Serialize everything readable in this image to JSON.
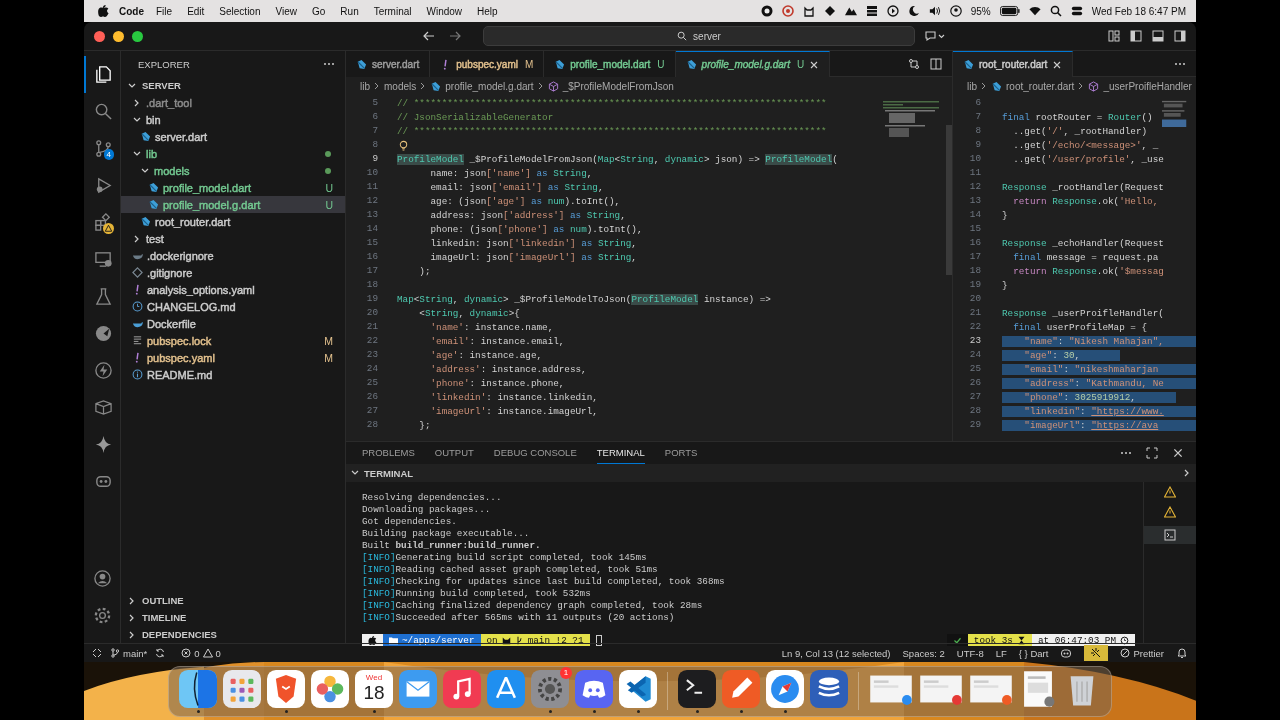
{
  "menubar": {
    "app": "Code",
    "menus": [
      "File",
      "Edit",
      "Selection",
      "View",
      "Go",
      "Run",
      "Terminal",
      "Window",
      "Help"
    ],
    "battery": "95%",
    "clock": "Wed Feb 18  6:47 PM"
  },
  "window": {
    "search": "server"
  },
  "activity_bar": [
    {
      "kind": "files",
      "selected": true
    },
    {
      "kind": "search",
      "selected": false
    },
    {
      "kind": "scm",
      "selected": false,
      "badge": "4"
    },
    {
      "kind": "debug",
      "selected": false
    },
    {
      "kind": "extensions",
      "selected": false
    },
    {
      "kind": "remote",
      "selected": false
    },
    {
      "kind": "testing",
      "selected": false
    },
    {
      "kind": "flutter",
      "selected": false
    },
    {
      "kind": "bolt",
      "selected": false
    },
    {
      "kind": "box",
      "selected": false
    },
    {
      "kind": "sparkle",
      "selected": false
    },
    {
      "kind": "bot",
      "selected": false
    }
  ],
  "sidebar": {
    "title": "EXPLORER",
    "root": "SERVER",
    "tree": [
      {
        "name": ".dart_tool",
        "kind": "folder",
        "color": "#8c8c8c",
        "expanded": false,
        "selected": false
      },
      {
        "name": "bin",
        "kind": "folder",
        "color": "#cccccc",
        "expanded": true,
        "selected": false,
        "children": [
          {
            "name": "server.dart",
            "kind": "dart",
            "color": "#cccccc",
            "selected": false
          }
        ]
      },
      {
        "name": "lib",
        "kind": "folder",
        "color": "#73c991",
        "changes_inside": true,
        "expanded": true,
        "selected": false,
        "children": [
          {
            "name": "models",
            "kind": "folder",
            "color": "#73c991",
            "changes_inside": true,
            "expanded": true,
            "selected": false,
            "children": [
              {
                "name": "profile_model.dart",
                "kind": "dart",
                "color": "#73c991",
                "badge": "U",
                "selected": false
              },
              {
                "name": "profile_model.g.dart",
                "kind": "dart",
                "color": "#73c991",
                "badge": "U",
                "selected": true
              }
            ]
          },
          {
            "name": "root_router.dart",
            "kind": "dart",
            "color": "#cccccc",
            "selected": false
          }
        ]
      },
      {
        "name": "test",
        "kind": "folder",
        "color": "#cccccc",
        "expanded": false,
        "selected": false
      },
      {
        "name": ".dockerignore",
        "kind": "dockerignore",
        "color": "#cccccc",
        "selected": false
      },
      {
        "name": ".gitignore",
        "kind": "git",
        "color": "#cccccc",
        "selected": false
      },
      {
        "name": "analysis_options.yaml",
        "kind": "yaml",
        "color": "#cccccc",
        "selected": false
      },
      {
        "name": "CHANGELOG.md",
        "kind": "changelog",
        "color": "#cccccc",
        "selected": false
      },
      {
        "name": "Dockerfile",
        "kind": "docker",
        "color": "#cccccc",
        "selected": false
      },
      {
        "name": "pubspec.lock",
        "kind": "lock",
        "color": "#e2c08d",
        "badge": "M",
        "selected": false
      },
      {
        "name": "pubspec.yaml",
        "kind": "yaml",
        "color": "#e2c08d",
        "badge": "M",
        "selected": false
      },
      {
        "name": "README.md",
        "kind": "info",
        "color": "#cccccc",
        "selected": false
      }
    ],
    "sections": [
      "OUTLINE",
      "TIMELINE",
      "DEPENDENCIES"
    ]
  },
  "editor": {
    "tabs": [
      {
        "label": "server.dart",
        "kind": "dart",
        "color": "#9d9d9d",
        "selected": false,
        "preview": false
      },
      {
        "label": "pubspec.yaml",
        "kind": "yaml",
        "color": "#e2c08d",
        "badge": "M",
        "selected": false,
        "preview": false
      },
      {
        "label": "profile_model.dart",
        "kind": "dart",
        "color": "#73c991",
        "badge": "U",
        "selected": false,
        "preview": false
      },
      {
        "label": "profile_model.g.dart",
        "kind": "dart",
        "color": "#73c991",
        "badge": "U",
        "selected": true,
        "preview": true
      }
    ],
    "breadcrumbs": [
      "lib",
      "models",
      "profile_model.g.dart",
      "_$ProfileModelFromJson"
    ],
    "lines": [
      {
        "n": "5",
        "active": false,
        "tokens": [
          {
            "kind": "comment",
            "text": "// **************************************************************************"
          }
        ]
      },
      {
        "n": "6",
        "active": false,
        "tokens": [
          {
            "kind": "comment",
            "text": "// JsonSerializableGenerator"
          }
        ]
      },
      {
        "n": "7",
        "active": false,
        "tokens": [
          {
            "kind": "comment",
            "text": "// **************************************************************************"
          }
        ]
      },
      {
        "n": "8",
        "active": false,
        "lightbulb": true
      },
      {
        "n": "9",
        "active": true,
        "tokens": [
          {
            "kind": "typesel",
            "text": "ProfileModel"
          },
          {
            "kind": "plain",
            "text": " _$ProfileModelFromJson("
          },
          {
            "kind": "type",
            "text": "Map"
          },
          {
            "kind": "plain",
            "text": "<"
          },
          {
            "kind": "type",
            "text": "String"
          },
          {
            "kind": "plain",
            "text": ", "
          },
          {
            "kind": "type",
            "text": "dynamic"
          },
          {
            "kind": "plain",
            "text": "> json) => "
          },
          {
            "kind": "typesel",
            "text": "ProfileModel"
          },
          {
            "kind": "plain",
            "text": "("
          }
        ]
      },
      {
        "n": "10",
        "active": false,
        "tokens": [
          {
            "kind": "plain",
            "text": "      name: json"
          },
          {
            "kind": "string",
            "text": "['name']"
          },
          {
            "kind": "keyword",
            "text": " as "
          },
          {
            "kind": "type",
            "text": "String"
          },
          {
            "kind": "plain",
            "text": ","
          }
        ]
      },
      {
        "n": "11",
        "active": false,
        "tokens": [
          {
            "kind": "plain",
            "text": "      email: json"
          },
          {
            "kind": "string",
            "text": "['email']"
          },
          {
            "kind": "keyword",
            "text": " as "
          },
          {
            "kind": "type",
            "text": "String"
          },
          {
            "kind": "plain",
            "text": ","
          }
        ]
      },
      {
        "n": "12",
        "active": false,
        "tokens": [
          {
            "kind": "plain",
            "text": "      age: (json"
          },
          {
            "kind": "string",
            "text": "['age']"
          },
          {
            "kind": "keyword",
            "text": " as "
          },
          {
            "kind": "type",
            "text": "num"
          },
          {
            "kind": "plain",
            "text": ").toInt(),"
          }
        ]
      },
      {
        "n": "13",
        "active": false,
        "tokens": [
          {
            "kind": "plain",
            "text": "      address: json"
          },
          {
            "kind": "string",
            "text": "['address']"
          },
          {
            "kind": "keyword",
            "text": " as "
          },
          {
            "kind": "type",
            "text": "String"
          },
          {
            "kind": "plain",
            "text": ","
          }
        ]
      },
      {
        "n": "14",
        "active": false,
        "tokens": [
          {
            "kind": "plain",
            "text": "      phone: (json"
          },
          {
            "kind": "string",
            "text": "['phone']"
          },
          {
            "kind": "keyword",
            "text": " as "
          },
          {
            "kind": "type",
            "text": "num"
          },
          {
            "kind": "plain",
            "text": ").toInt(),"
          }
        ]
      },
      {
        "n": "15",
        "active": false,
        "tokens": [
          {
            "kind": "plain",
            "text": "      linkedin: json"
          },
          {
            "kind": "string",
            "text": "['linkedin']"
          },
          {
            "kind": "keyword",
            "text": " as "
          },
          {
            "kind": "type",
            "text": "String"
          },
          {
            "kind": "plain",
            "text": ","
          }
        ]
      },
      {
        "n": "16",
        "active": false,
        "tokens": [
          {
            "kind": "plain",
            "text": "      imageUrl: json"
          },
          {
            "kind": "string",
            "text": "['imageUrl']"
          },
          {
            "kind": "keyword",
            "text": " as "
          },
          {
            "kind": "type",
            "text": "String"
          },
          {
            "kind": "plain",
            "text": ","
          }
        ]
      },
      {
        "n": "17",
        "active": false,
        "tokens": [
          {
            "kind": "plain",
            "text": "    );"
          }
        ]
      },
      {
        "n": "18",
        "active": false
      },
      {
        "n": "19",
        "active": false,
        "tokens": [
          {
            "kind": "type",
            "text": "Map"
          },
          {
            "kind": "plain",
            "text": "<"
          },
          {
            "kind": "type",
            "text": "String"
          },
          {
            "kind": "plain",
            "text": ", "
          },
          {
            "kind": "type",
            "text": "dynamic"
          },
          {
            "kind": "plain",
            "text": "> _$ProfileModelToJson("
          },
          {
            "kind": "typesel",
            "text": "ProfileModel"
          },
          {
            "kind": "plain",
            "text": " instance) =>"
          }
        ]
      },
      {
        "n": "20",
        "active": false,
        "tokens": [
          {
            "kind": "plain",
            "text": "    <"
          },
          {
            "kind": "type",
            "text": "String"
          },
          {
            "kind": "plain",
            "text": ", "
          },
          {
            "kind": "type",
            "text": "dynamic"
          },
          {
            "kind": "plain",
            "text": ">{"
          }
        ]
      },
      {
        "n": "21",
        "active": false,
        "tokens": [
          {
            "kind": "string",
            "text": "      'name'"
          },
          {
            "kind": "plain",
            "text": ": instance.name,"
          }
        ]
      },
      {
        "n": "22",
        "active": false,
        "tokens": [
          {
            "kind": "string",
            "text": "      'email'"
          },
          {
            "kind": "plain",
            "text": ": instance.email,"
          }
        ]
      },
      {
        "n": "23",
        "active": false,
        "tokens": [
          {
            "kind": "string",
            "text": "      'age'"
          },
          {
            "kind": "plain",
            "text": ": instance.age,"
          }
        ]
      },
      {
        "n": "24",
        "active": false,
        "tokens": [
          {
            "kind": "string",
            "text": "      'address'"
          },
          {
            "kind": "plain",
            "text": ": instance.address,"
          }
        ]
      },
      {
        "n": "25",
        "active": false,
        "tokens": [
          {
            "kind": "string",
            "text": "      'phone'"
          },
          {
            "kind": "plain",
            "text": ": instance.phone,"
          }
        ]
      },
      {
        "n": "26",
        "active": false,
        "tokens": [
          {
            "kind": "string",
            "text": "      'linkedin'"
          },
          {
            "kind": "plain",
            "text": ": instance.linkedin,"
          }
        ]
      },
      {
        "n": "27",
        "active": false,
        "tokens": [
          {
            "kind": "string",
            "text": "      'imageUrl'"
          },
          {
            "kind": "plain",
            "text": ": instance.imageUrl,"
          }
        ]
      },
      {
        "n": "28",
        "active": false,
        "tokens": [
          {
            "kind": "plain",
            "text": "    };"
          }
        ]
      }
    ]
  },
  "side_editor": {
    "tab": {
      "label": "root_router.dart",
      "selected": true
    },
    "breadcrumbs": [
      "lib",
      "root_router.dart",
      "_userProifleHandler"
    ],
    "lines": [
      {
        "n": "6",
        "active": false
      },
      {
        "n": "7",
        "active": false,
        "selected": false,
        "tokens": [
          {
            "kind": "keyword",
            "text": "final"
          },
          {
            "kind": "plain",
            "text": " rootRouter = "
          },
          {
            "kind": "type",
            "text": "Router"
          },
          {
            "kind": "plain",
            "text": "()"
          }
        ]
      },
      {
        "n": "8",
        "active": false,
        "selected": false,
        "tokens": [
          {
            "kind": "plain",
            "text": "  ..get("
          },
          {
            "kind": "string",
            "text": "'/'"
          },
          {
            "kind": "plain",
            "text": ", _rootHandler)"
          }
        ]
      },
      {
        "n": "9",
        "active": false,
        "selected": false,
        "tokens": [
          {
            "kind": "plain",
            "text": "  ..get("
          },
          {
            "kind": "string",
            "text": "'/echo/<message>'"
          },
          {
            "kind": "plain",
            "text": ", _"
          }
        ]
      },
      {
        "n": "10",
        "active": false,
        "selected": false,
        "tokens": [
          {
            "kind": "plain",
            "text": "  ..get("
          },
          {
            "kind": "string",
            "text": "'/user/profile'"
          },
          {
            "kind": "plain",
            "text": ", _use"
          }
        ]
      },
      {
        "n": "11",
        "active": false
      },
      {
        "n": "12",
        "active": false,
        "selected": false,
        "tokens": [
          {
            "kind": "type",
            "text": "Response"
          },
          {
            "kind": "plain",
            "text": " _rootHandler(Request"
          }
        ]
      },
      {
        "n": "13",
        "active": false,
        "selected": false,
        "tokens": [
          {
            "kind": "control",
            "text": "  return"
          },
          {
            "kind": "type",
            "text": " Response"
          },
          {
            "kind": "plain",
            "text": ".ok("
          },
          {
            "kind": "string",
            "text": "'Hello,"
          }
        ]
      },
      {
        "n": "14",
        "active": false,
        "selected": false,
        "tokens": [
          {
            "kind": "plain",
            "text": "}"
          }
        ]
      },
      {
        "n": "15",
        "active": false
      },
      {
        "n": "16",
        "active": false,
        "selected": false,
        "tokens": [
          {
            "kind": "type",
            "text": "Response"
          },
          {
            "kind": "plain",
            "text": " _echoHandler(Request"
          }
        ]
      },
      {
        "n": "17",
        "active": false,
        "selected": false,
        "tokens": [
          {
            "kind": "keyword",
            "text": "  final"
          },
          {
            "kind": "plain",
            "text": " message = request.pa"
          }
        ]
      },
      {
        "n": "18",
        "active": false,
        "selected": false,
        "tokens": [
          {
            "kind": "control",
            "text": "  return"
          },
          {
            "kind": "type",
            "text": " Response"
          },
          {
            "kind": "plain",
            "text": ".ok("
          },
          {
            "kind": "string",
            "text": "'$messag"
          }
        ]
      },
      {
        "n": "19",
        "active": false,
        "selected": false,
        "tokens": [
          {
            "kind": "plain",
            "text": "}"
          }
        ]
      },
      {
        "n": "20",
        "active": false
      },
      {
        "n": "21",
        "active": false,
        "selected": false,
        "tokens": [
          {
            "kind": "type",
            "text": "Response"
          },
          {
            "kind": "plain",
            "text": " _userProifleHandler("
          }
        ]
      },
      {
        "n": "22",
        "active": false,
        "selected": false,
        "tokens": [
          {
            "kind": "keyword",
            "text": "  final"
          },
          {
            "kind": "plain",
            "text": " userProfileMap = {"
          }
        ]
      },
      {
        "n": "23",
        "active": true,
        "selected": true,
        "tokens": [
          {
            "kind": "string",
            "text": "    \"name\""
          },
          {
            "kind": "plain",
            "text": ": "
          },
          {
            "kind": "string",
            "text": "\"Nikesh Mahajan\","
          }
        ]
      },
      {
        "n": "24",
        "active": false,
        "selected": true,
        "tokens": [
          {
            "kind": "string",
            "text": "    \"age\""
          },
          {
            "kind": "plain",
            "text": ": "
          },
          {
            "kind": "number",
            "text": "30"
          },
          {
            "kind": "plain",
            "text": ","
          }
        ]
      },
      {
        "n": "25",
        "active": false,
        "selected": true,
        "tokens": [
          {
            "kind": "string",
            "text": "    \"email\""
          },
          {
            "kind": "plain",
            "text": ": "
          },
          {
            "kind": "string",
            "text": "\"nikeshmaharjan"
          }
        ]
      },
      {
        "n": "26",
        "active": false,
        "selected": true,
        "tokens": [
          {
            "kind": "string",
            "text": "    \"address\""
          },
          {
            "kind": "plain",
            "text": ": "
          },
          {
            "kind": "string",
            "text": "\"Kathmandu, Ne"
          }
        ]
      },
      {
        "n": "27",
        "active": false,
        "selected": true,
        "tokens": [
          {
            "kind": "string",
            "text": "    \"phone\""
          },
          {
            "kind": "plain",
            "text": ": "
          },
          {
            "kind": "number",
            "text": "3025919912"
          },
          {
            "kind": "plain",
            "text": ","
          }
        ]
      },
      {
        "n": "28",
        "active": false,
        "selected": true,
        "tokens": [
          {
            "kind": "string",
            "text": "    \"linkedin\""
          },
          {
            "kind": "plain",
            "text": ": "
          },
          {
            "kind": "link",
            "text": "\"https://www."
          }
        ]
      },
      {
        "n": "29",
        "active": false,
        "selected": true,
        "tokens": [
          {
            "kind": "string",
            "text": "    \"imageUrl\""
          },
          {
            "kind": "plain",
            "text": ": "
          },
          {
            "kind": "link",
            "text": "\"https://ava"
          }
        ]
      }
    ]
  },
  "panel": {
    "tabs": [
      {
        "label": "PROBLEMS",
        "selected": false
      },
      {
        "label": "OUTPUT",
        "selected": false
      },
      {
        "label": "DEBUG CONSOLE",
        "selected": false
      },
      {
        "label": "TERMINAL",
        "selected": true
      },
      {
        "label": "PORTS",
        "selected": false
      }
    ],
    "header": "TERMINAL",
    "lines": [
      {
        "text": "Resolving dependencies..."
      },
      {
        "text": "Downloading packages..."
      },
      {
        "text": "Got dependencies."
      },
      {
        "text": "Building package executable..."
      },
      {
        "text": "Built **build_runner:build_runner.**"
      },
      {
        "tag": "[INFO]",
        "text": "Generating build script completed, took 145ms"
      },
      {
        "tag": "[INFO]",
        "text": "Reading cached asset graph completed, took 51ms"
      },
      {
        "tag": "[INFO]",
        "text": "Checking for updates since last build completed, took 368ms"
      },
      {
        "tag": "[INFO]",
        "text": "Running build completed, took 532ms"
      },
      {
        "tag": "[INFO]",
        "text": "Caching finalized dependency graph completed, took 28ms"
      },
      {
        "tag": "[INFO]",
        "text": "Succeeded after 565ms with 11 outputs (20 actions)"
      }
    ],
    "prompt": {
      "dir": "~/apps/server",
      "on": "on",
      "branch": "main !2 ?1",
      "took": "took 3s",
      "at": "at 06:47:03 PM"
    }
  },
  "status_bar": {
    "branch": "main*",
    "errors": "0",
    "warnings": "0",
    "position": "Ln 9, Col 13 (12 selected)",
    "spaces": "Spaces: 2",
    "encoding": "UTF-8",
    "eol": "LF",
    "braces": "{ }",
    "language": "Dart",
    "formatter": "Prettier"
  },
  "dock": [
    {
      "kind": "finder",
      "running": true
    },
    {
      "kind": "launchpad",
      "running": false
    },
    {
      "kind": "brave",
      "running": true
    },
    {
      "kind": "photos",
      "running": false
    },
    {
      "kind": "calendar",
      "day": "Wed",
      "date": "18",
      "running": true
    },
    {
      "kind": "mail",
      "running": false
    },
    {
      "kind": "music",
      "running": false
    },
    {
      "kind": "store",
      "running": false
    },
    {
      "kind": "settings",
      "badge": "1",
      "running": true
    },
    {
      "kind": "discord",
      "running": true
    },
    {
      "kind": "vscode",
      "running": true
    },
    {
      "kind": "separator"
    },
    {
      "kind": "terminal",
      "running": true
    },
    {
      "kind": "postman",
      "running": true
    },
    {
      "kind": "safari",
      "running": true
    },
    {
      "kind": "dbapp",
      "running": false
    },
    {
      "kind": "separator"
    },
    {
      "kind": "thumb",
      "running": false
    },
    {
      "kind": "thumb",
      "running": false
    },
    {
      "kind": "thumb",
      "running": false
    },
    {
      "kind": "doc",
      "running": false
    },
    {
      "kind": "trash",
      "running": false
    }
  ]
}
